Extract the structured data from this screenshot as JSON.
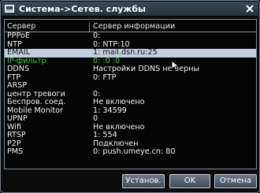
{
  "window": {
    "title": "Система->Сетев. службы"
  },
  "table": {
    "headers": [
      "Сервер",
      "Сервер информации"
    ],
    "rows": [
      [
        "PPPoE",
        "0:"
      ],
      [
        "NTP",
        "0: NTP:10"
      ],
      [
        "EMAIL",
        "1: mail.dsn.ru:25"
      ],
      [
        "IP-фильтр",
        "0: :0 :0"
      ],
      [
        "DDNS",
        "Настройки DDNS не верны"
      ],
      [
        "FTP",
        "0: FTP"
      ],
      [
        "ARSP",
        ""
      ],
      [
        "центр тревоги",
        "0:"
      ],
      [
        "Беспров. соед.",
        "Не включено"
      ],
      [
        "Mobile Monitor",
        "1: 34599"
      ],
      [
        "UPNP",
        "0"
      ],
      [
        "Wifi",
        "Не включено"
      ],
      [
        "RTSP",
        "1: 554"
      ],
      [
        "P2P",
        "Подключен"
      ],
      [
        "PMS",
        "0: push.umeye.cn: 80"
      ]
    ],
    "selected_row": 2,
    "highlight_row": 3
  },
  "buttons": {
    "setup": "Установ.",
    "ok": "OK",
    "cancel": "Отмена"
  },
  "colors": {
    "highlight_text": "#36d53a",
    "selected_bg": "#c3cfe0"
  },
  "icons": {
    "title": "window-icon",
    "close": "close-icon",
    "cursor": "mouse-pointer-icon"
  }
}
